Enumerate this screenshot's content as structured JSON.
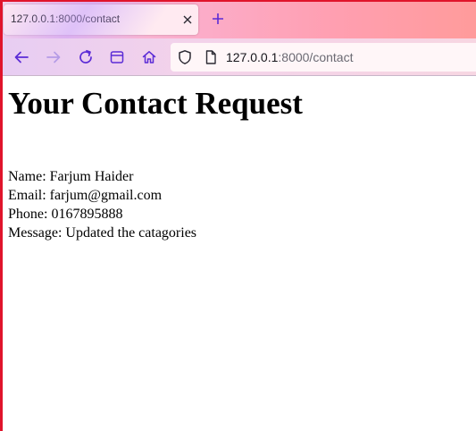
{
  "browser": {
    "tab": {
      "title": "127.0.0.1:8000/contact"
    },
    "url": {
      "host": "127.0.0.1",
      "rest": ":8000/contact"
    },
    "icons": {
      "back": "arrow-left-icon",
      "forward": "arrow-right-icon",
      "reload": "reload-icon",
      "sidebar": "sidebar-icon",
      "home": "home-icon",
      "shield": "shield-icon",
      "page": "page-icon",
      "close": "close-icon",
      "new_tab": "plus-icon"
    },
    "colors": {
      "accent": "#5b2bd6",
      "frame": "#e0142b"
    }
  },
  "page": {
    "title": "Your Contact Request",
    "details": [
      {
        "text": "Name: Farjum Haider"
      },
      {
        "text": "Email: farjum@gmail.com"
      },
      {
        "text": "Phone: 0167895888"
      },
      {
        "text": "Message: Updated the catagories"
      }
    ]
  }
}
